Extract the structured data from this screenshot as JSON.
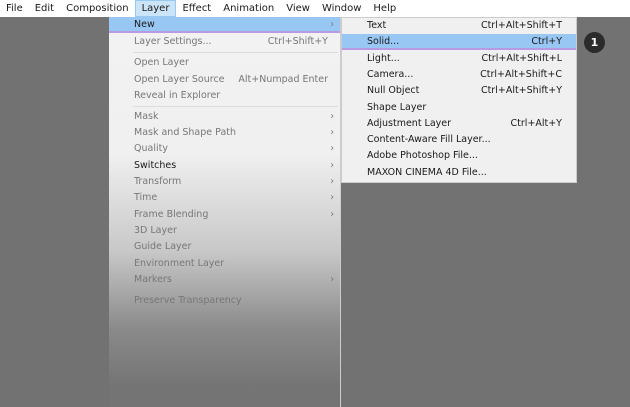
{
  "menubar": [
    "File",
    "Edit",
    "Composition",
    "Layer",
    "Effect",
    "Animation",
    "View",
    "Window",
    "Help"
  ],
  "layer_menu": [
    {
      "label": "New",
      "shortcut": "",
      "arrow": true,
      "state": "highlight"
    },
    {
      "label": "Layer Settings...",
      "shortcut": "Ctrl+Shift+Y",
      "state": "disabled"
    },
    {
      "label": "Open Layer",
      "shortcut": "",
      "state": "disabled"
    },
    {
      "label": "Open Layer Source",
      "shortcut": "Alt+Numpad Enter",
      "state": "disabled"
    },
    {
      "label": "Reveal in Explorer",
      "shortcut": "",
      "state": "disabled"
    },
    {
      "label": "Mask",
      "arrow": true,
      "state": "disabled"
    },
    {
      "label": "Mask and Shape Path",
      "arrow": true,
      "state": "disabled"
    },
    {
      "label": "Quality",
      "arrow": true,
      "state": "disabled"
    },
    {
      "label": "Switches",
      "arrow": true,
      "state": "enabled"
    },
    {
      "label": "Transform",
      "arrow": true,
      "state": "disabled"
    },
    {
      "label": "Time",
      "arrow": true,
      "state": "disabled"
    },
    {
      "label": "Frame Blending",
      "arrow": true,
      "state": "disabled"
    },
    {
      "label": "3D Layer",
      "state": "disabled"
    },
    {
      "label": "Guide Layer",
      "state": "disabled"
    },
    {
      "label": "Environment Layer",
      "state": "disabled"
    },
    {
      "label": "Markers",
      "arrow": true,
      "state": "disabled"
    },
    {
      "label": "Preserve Transparency",
      "state": "disabled"
    }
  ],
  "new_submenu": [
    {
      "label": "Text",
      "shortcut": "Ctrl+Alt+Shift+T"
    },
    {
      "label": "Solid...",
      "shortcut": "Ctrl+Y",
      "highlight": true
    },
    {
      "label": "Light...",
      "shortcut": "Ctrl+Alt+Shift+L"
    },
    {
      "label": "Camera...",
      "shortcut": "Ctrl+Alt+Shift+C"
    },
    {
      "label": "Null Object",
      "shortcut": "Ctrl+Alt+Shift+Y"
    },
    {
      "label": "Shape Layer",
      "shortcut": ""
    },
    {
      "label": "Adjustment Layer",
      "shortcut": "Ctrl+Alt+Y"
    },
    {
      "label": "Content-Aware Fill Layer...",
      "shortcut": ""
    },
    {
      "label": "Adobe Photoshop File...",
      "shortcut": ""
    },
    {
      "label": "MAXON CINEMA 4D File...",
      "shortcut": ""
    }
  ],
  "step_badge": "1"
}
